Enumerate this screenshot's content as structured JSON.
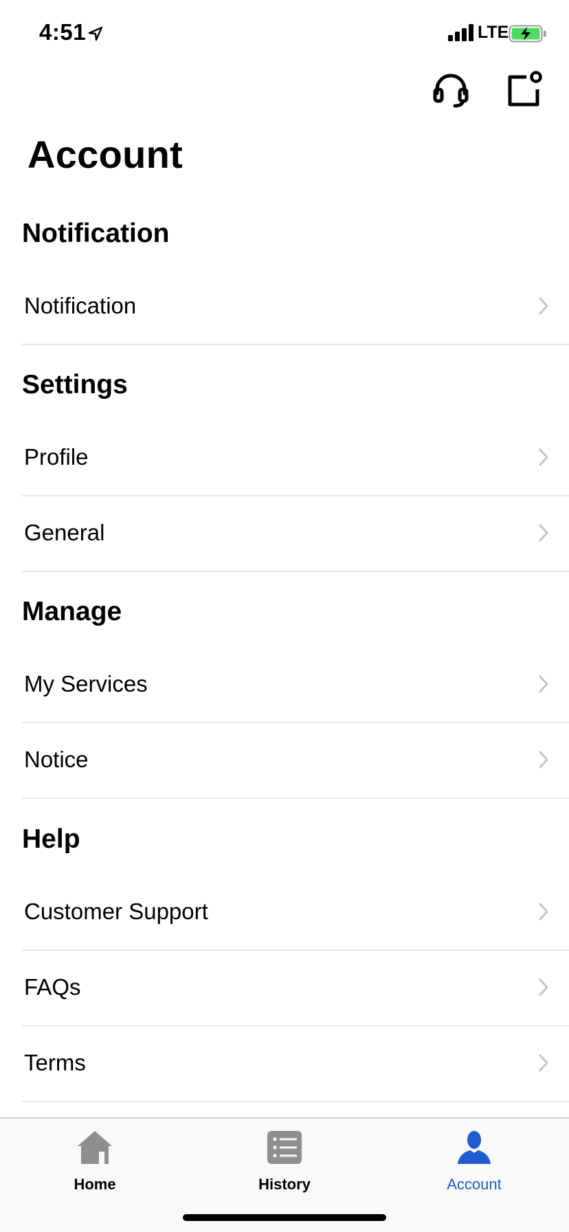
{
  "status_bar": {
    "time": "4:51",
    "network": "LTE",
    "icons": [
      "location-arrow-icon",
      "signal-icon",
      "battery-charging-icon"
    ],
    "battery_color": "#4cd964"
  },
  "header": {
    "actions": [
      "headset-icon",
      "compose-icon"
    ],
    "title": "Account"
  },
  "sections": {
    "notification": {
      "title": "Notification",
      "items": [
        {
          "label": "Notification"
        }
      ]
    },
    "settings": {
      "title": "Settings",
      "items": [
        {
          "label": "Profile"
        },
        {
          "label": "General"
        }
      ]
    },
    "manage": {
      "title": "Manage",
      "items": [
        {
          "label": "My Services"
        },
        {
          "label": "Notice"
        }
      ]
    },
    "help": {
      "title": "Help",
      "items": [
        {
          "label": "Customer Support"
        },
        {
          "label": "FAQs"
        },
        {
          "label": "Terms"
        }
      ]
    }
  },
  "tab_bar": {
    "tabs": [
      {
        "label": "Home",
        "icon": "home-icon",
        "active": false
      },
      {
        "label": "History",
        "icon": "list-icon",
        "active": false
      },
      {
        "label": "Account",
        "icon": "person-icon",
        "active": true
      }
    ],
    "active_color": "#1f5bd1",
    "inactive_icon_color": "#8e8e8e"
  }
}
